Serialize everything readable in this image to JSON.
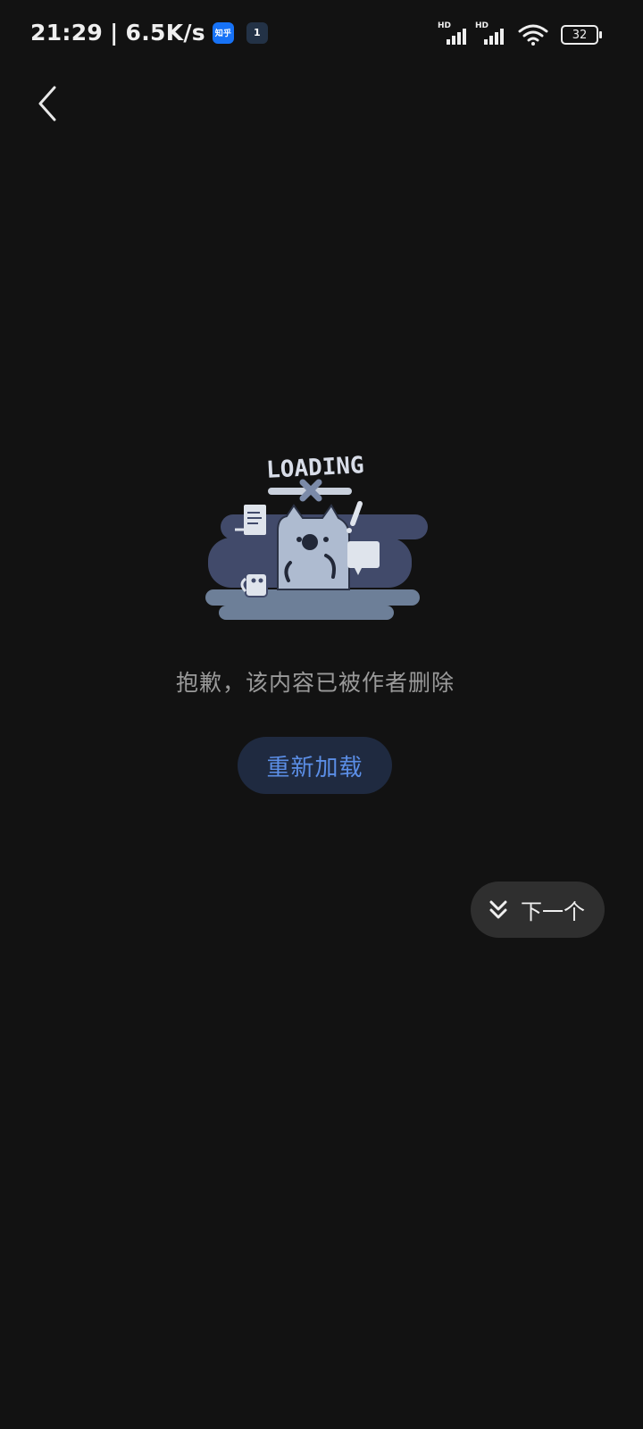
{
  "status_bar": {
    "time": "21:29",
    "separator": "|",
    "network_speed": "6.5K/s",
    "app_icon_1": "知乎",
    "app_icon_2": "1",
    "signal_1_label": "HD",
    "signal_2_label": "HD",
    "battery_level": "32",
    "icons": [
      "zhihu-app-icon",
      "notification-app-icon",
      "signal-icon",
      "signal-icon",
      "wifi-icon",
      "battery-icon"
    ]
  },
  "nav": {
    "back_icon": "chevron-left-icon"
  },
  "illustration": {
    "loading_text": "LOADING"
  },
  "content": {
    "message": "抱歉，该内容已被作者删除",
    "reload_label": "重新加载",
    "next_label": "下一个",
    "next_icon": "double-chevron-down-icon"
  },
  "colors": {
    "background": "#121212",
    "reload_bg": "#1f2a40",
    "reload_text": "#5b8ee6",
    "next_bg": "#2f2f2f"
  }
}
